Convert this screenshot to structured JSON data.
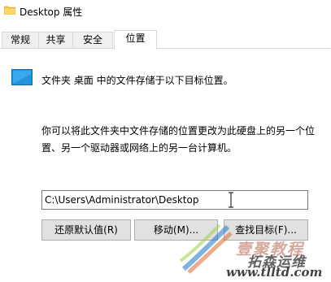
{
  "window": {
    "title": "Desktop 属性"
  },
  "tabs": [
    {
      "label": "常规",
      "active": false
    },
    {
      "label": "共享",
      "active": false
    },
    {
      "label": "安全",
      "active": false
    },
    {
      "label": "位置",
      "active": true
    }
  ],
  "location": {
    "title": "文件夹 桌面 中的文件存储于以下目标位置。",
    "description": "你可以将此文件夹中文件存储的位置更改为此硬盘上的另一个位置、另一个驱动器或网络上的另一台计算机。",
    "path_value": "C:\\Users\\Administrator\\Desktop"
  },
  "buttons": {
    "restore_default": "还原默认值(R)",
    "move": "移动(M)...",
    "find_target": "查找目标(F)..."
  },
  "watermark": {
    "line1": "壹聚教程",
    "line2": "拓森运维",
    "line3": "www.tlltd.com"
  },
  "colors": {
    "tab_border": "#d9d9d9",
    "button_face": "#e1e1e1",
    "button_border": "#adadad",
    "desktop_icon_blue": "#1e8fd9"
  },
  "icons": {
    "title_icon": "folder-icon",
    "location_icon": "desktop-icon",
    "cursor": "text-cursor-icon"
  }
}
